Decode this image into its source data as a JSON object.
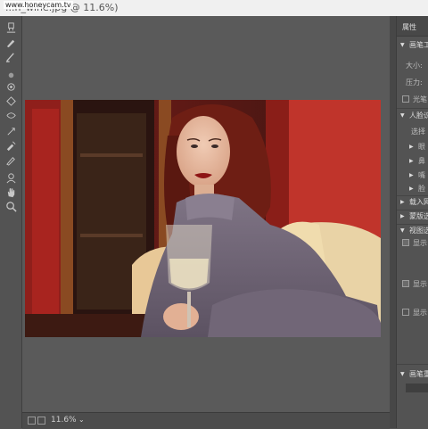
{
  "window": {
    "title": "...h_wine.jpg @ 11.6%)",
    "watermark": "www.honeycam.tv"
  },
  "toolbar": {
    "tools": [
      {
        "name": "clone-stamp-icon"
      },
      {
        "name": "brush-icon"
      },
      {
        "name": "pencil-icon"
      },
      {
        "name": "blur-icon"
      },
      {
        "name": "bloat-icon"
      },
      {
        "name": "pucker-icon"
      },
      {
        "name": "twirl-icon"
      },
      {
        "name": "push-left-icon"
      },
      {
        "name": "freeze-mask-icon"
      },
      {
        "name": "thaw-mask-icon"
      },
      {
        "name": "face-tool-icon"
      },
      {
        "name": "hand-icon"
      },
      {
        "name": "zoom-icon"
      }
    ]
  },
  "status": {
    "zoom": "11.6%",
    "caret": "⌄"
  },
  "panel": {
    "tab": "属性",
    "sections": [
      {
        "label": "画笔工"
      },
      {
        "label": "大小:"
      },
      {
        "label": "压力:"
      },
      {
        "label": "光笔"
      },
      {
        "label": "人脸识"
      },
      {
        "label": "选择"
      },
      {
        "label": "眼"
      },
      {
        "label": "鼻"
      },
      {
        "label": "嘴"
      },
      {
        "label": "脸"
      },
      {
        "label": "载入网"
      },
      {
        "label": "蒙版选"
      },
      {
        "label": "视图选"
      },
      {
        "label": "显示"
      },
      {
        "label": "显示"
      },
      {
        "label": "显示"
      },
      {
        "label": "画笔重"
      }
    ]
  },
  "colors": {
    "ui_bg": "#535353",
    "panel_text": "#dcdcdc",
    "photo_red": "#b8342c"
  }
}
